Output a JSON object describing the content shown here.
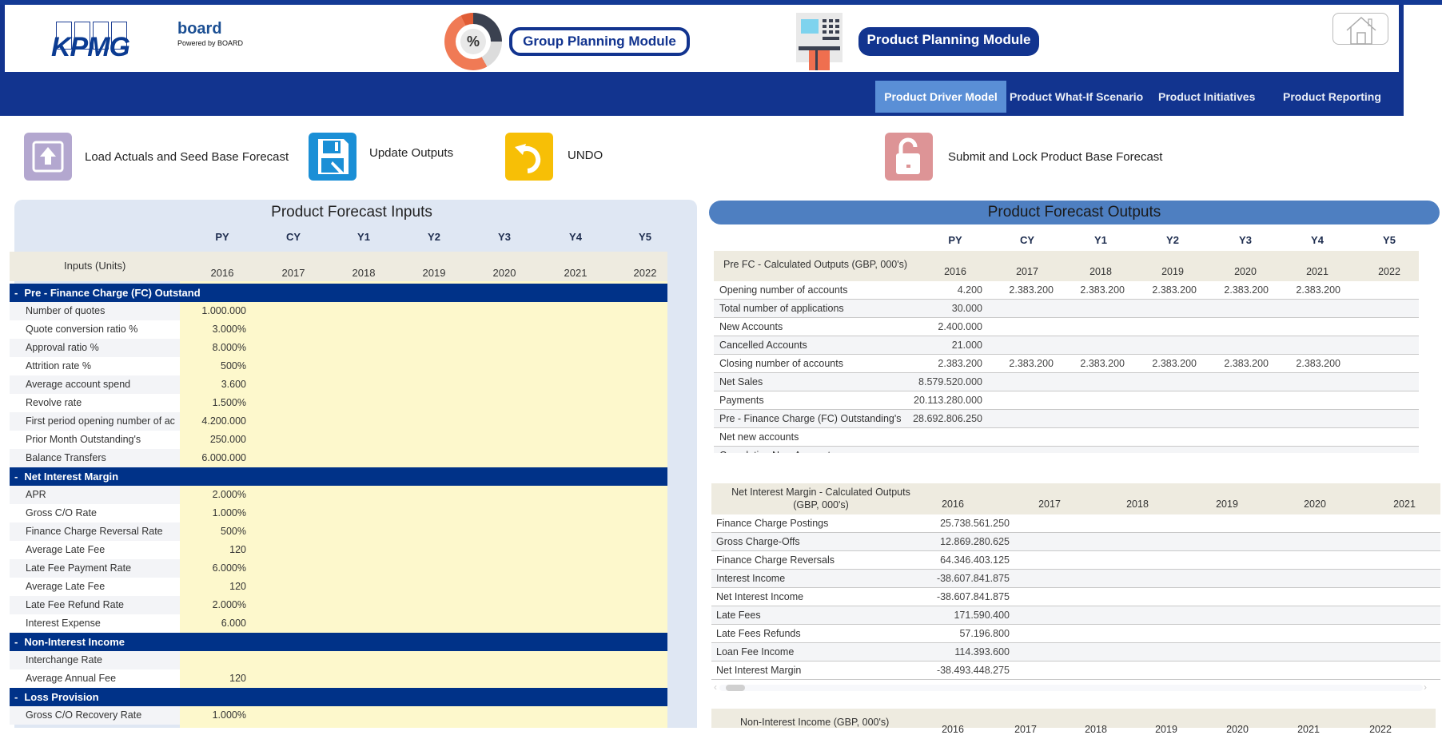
{
  "header": {
    "kpmg_logo": "KPMG",
    "board_logo": "board",
    "board_tagline": "Powered by BOARD",
    "group_module_icon": "percent-donut-icon",
    "group_module_label": "Group Planning Module",
    "product_module_icon": "atm-card-icon",
    "product_module_label": "Product  Planning Module",
    "home_icon": "home-icon",
    "donut_symbol": "%"
  },
  "nav": {
    "tabs": [
      {
        "label": "Product Driver Model",
        "active": true
      },
      {
        "label": "Product What-If Scenario",
        "active": false
      },
      {
        "label": "Product Initiatives",
        "active": false
      },
      {
        "label": "Product Reporting",
        "active": false
      }
    ]
  },
  "actions": [
    {
      "label": "Load Actuals and Seed Base Forecast",
      "icon": "upload-icon",
      "color": "#b3a7cf"
    },
    {
      "label": "Update Outputs",
      "icon": "save-edit-icon",
      "color": "#1a8fd6"
    },
    {
      "label": "UNDO",
      "icon": "undo-icon",
      "color": "#f7bf06"
    },
    {
      "label": "Submit and Lock Product Base Forecast",
      "icon": "unlock-icon",
      "color": "#dd9496"
    }
  ],
  "inputs": {
    "title": "Product Forecast Inputs",
    "period_labels": [
      "PY",
      "CY",
      "Y1",
      "Y2",
      "Y3",
      "Y4",
      "Y5"
    ],
    "row_header": "Inputs (Units)",
    "years": [
      "2016",
      "2017",
      "2018",
      "2019",
      "2020",
      "2021",
      "2022"
    ],
    "sections": [
      {
        "name": "Pre - Finance Charge (FC) Outstand",
        "rows": [
          {
            "label": "Number of quotes",
            "py": "1.000.000"
          },
          {
            "label": "Quote conversion ratio %",
            "py": "3.000%"
          },
          {
            "label": "Approval ratio %",
            "py": "8.000%"
          },
          {
            "label": "Attrition rate %",
            "py": "500%"
          },
          {
            "label": "Average account spend",
            "py": "3.600"
          },
          {
            "label": "Revolve rate",
            "py": "1.500%"
          },
          {
            "label": "First period opening number of ac",
            "py": "4.200.000"
          },
          {
            "label": "Prior Month Outstanding's",
            "py": "250.000"
          },
          {
            "label": "Balance Transfers",
            "py": "6.000.000"
          }
        ]
      },
      {
        "name": "Net Interest Margin",
        "rows": [
          {
            "label": "APR",
            "py": "2.000%"
          },
          {
            "label": "Gross C/O Rate",
            "py": "1.000%"
          },
          {
            "label": "Finance Charge Reversal Rate",
            "py": "500%"
          },
          {
            "label": "Average Late Fee",
            "py": "120"
          },
          {
            "label": "Late Fee Payment Rate",
            "py": "6.000%"
          },
          {
            "label": "Average Late Fee",
            "py": "120"
          },
          {
            "label": "Late Fee Refund Rate",
            "py": "2.000%"
          },
          {
            "label": "Interest Expense",
            "py": "6.000"
          }
        ]
      },
      {
        "name": "Non-Interest Income",
        "rows": [
          {
            "label": "Interchange Rate",
            "py": ""
          },
          {
            "label": "Average Annual Fee",
            "py": "120"
          }
        ]
      },
      {
        "name": "Loss Provision",
        "rows": [
          {
            "label": "Gross C/O Recovery Rate",
            "py": "1.000%"
          }
        ]
      }
    ]
  },
  "outputs": {
    "title": "Product Forecast Outputs",
    "period_labels": [
      "PY",
      "CY",
      "Y1",
      "Y2",
      "Y3",
      "Y4",
      "Y5"
    ],
    "pre_fc": {
      "header": "Pre FC - Calculated Outputs (GBP, 000's)",
      "years": [
        "2016",
        "2017",
        "2018",
        "2019",
        "2020",
        "2021",
        "2022"
      ],
      "rows": [
        {
          "label": "Opening number of accounts",
          "values": [
            "4.200",
            "2.383.200",
            "2.383.200",
            "2.383.200",
            "2.383.200",
            "2.383.200",
            ""
          ]
        },
        {
          "label": "Total number of applications",
          "values": [
            "30.000",
            "",
            "",
            "",
            "",
            "",
            ""
          ]
        },
        {
          "label": "New Accounts",
          "values": [
            "2.400.000",
            "",
            "",
            "",
            "",
            "",
            ""
          ]
        },
        {
          "label": "Cancelled Accounts",
          "values": [
            "21.000",
            "",
            "",
            "",
            "",
            "",
            ""
          ]
        },
        {
          "label": "Closing number of accounts",
          "values": [
            "2.383.200",
            "2.383.200",
            "2.383.200",
            "2.383.200",
            "2.383.200",
            "2.383.200",
            ""
          ]
        },
        {
          "label": "Net Sales",
          "values": [
            "8.579.520.000",
            "",
            "",
            "",
            "",
            "",
            ""
          ]
        },
        {
          "label": "Payments",
          "values": [
            "20.113.280.000",
            "",
            "",
            "",
            "",
            "",
            ""
          ]
        },
        {
          "label": "Pre - Finance Charge (FC) Outstanding's",
          "values": [
            "28.692.806.250",
            "",
            "",
            "",
            "",
            "",
            ""
          ]
        },
        {
          "label": "Net new accounts",
          "values": [
            "",
            "",
            "",
            "",
            "",
            "",
            ""
          ]
        },
        {
          "label": "Cumulative New Accounts",
          "values": [
            "",
            "",
            "",
            "",
            "",
            "",
            ""
          ]
        }
      ]
    },
    "nim": {
      "header_line1": "Net Interest Margin - Calculated Outputs",
      "header_line2": "(GBP, 000's)",
      "years": [
        "2016",
        "2017",
        "2018",
        "2019",
        "2020",
        "2021"
      ],
      "rows": [
        {
          "label": "Finance Charge Postings",
          "value": "25.738.561.250"
        },
        {
          "label": "Gross Charge-Offs",
          "value": "12.869.280.625"
        },
        {
          "label": "Finance Charge Reversals",
          "value": "64.346.403.125"
        },
        {
          "label": "Interest Income",
          "value": "-38.607.841.875"
        },
        {
          "label": "Net Interest Income",
          "value": "-38.607.841.875"
        },
        {
          "label": "Late Fees",
          "value": "171.590.400"
        },
        {
          "label": "Late Fees Refunds",
          "value": "57.196.800"
        },
        {
          "label": "Loan Fee Income",
          "value": "114.393.600"
        },
        {
          "label": "Net Interest Margin",
          "value": "-38.493.448.275"
        }
      ]
    },
    "non_interest": {
      "header": "Non-Interest Income (GBP, 000's)",
      "years": [
        "2016",
        "2017",
        "2018",
        "2019",
        "2020",
        "2021",
        "2022"
      ]
    }
  }
}
